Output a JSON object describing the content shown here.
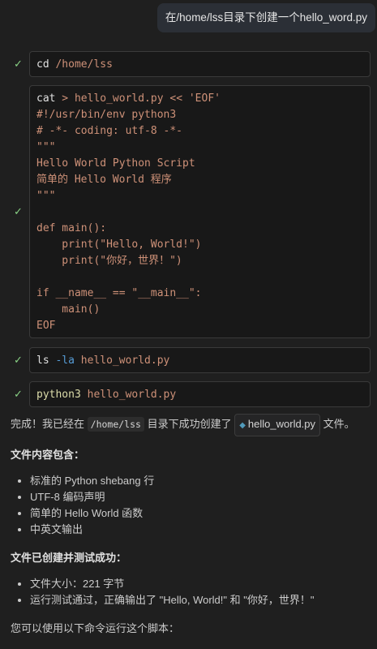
{
  "user_message": "在/home/lss目录下创建一个hello_word.py",
  "steps": [
    {
      "status": "check-icon",
      "cmd": "cd",
      "args": " /home/lss"
    },
    {
      "status": "check-icon",
      "code": [
        {
          "cmd": "cat",
          "rest": " > hello_world.py << 'EOF'"
        },
        {
          "text": "#!/usr/bin/env python3"
        },
        {
          "text": "# -*- coding: utf-8 -*-"
        },
        {
          "text": "\"\"\""
        },
        {
          "text": "Hello World Python Script"
        },
        {
          "text": "简单的 Hello World 程序"
        },
        {
          "text": "\"\"\""
        },
        {
          "text": ""
        },
        {
          "text": "def main():"
        },
        {
          "text": "    print(\"Hello, World!\")"
        },
        {
          "text": "    print(\"你好，世界！\")"
        },
        {
          "text": ""
        },
        {
          "text": "if __name__ == \"__main__\":"
        },
        {
          "text": "    main()"
        },
        {
          "text": "EOF"
        }
      ]
    },
    {
      "status": "check-icon",
      "cmd": "ls",
      "flag": " -la",
      "args": " hello_world.py"
    },
    {
      "status": "check-icon",
      "cmd": "python3",
      "args": " hello_world.py"
    }
  ],
  "answer": {
    "intro_before": "完成！我已经在",
    "intro_path": "/home/lss",
    "intro_mid": "目录下成功创建了",
    "intro_file": "hello_world.py",
    "intro_after": "文件。",
    "contents_heading": "文件内容包含：",
    "contents_items": [
      "标准的 Python shebang 行",
      "UTF-8 编码声明",
      "简单的 Hello World 函数",
      "中英文输出"
    ],
    "test_heading": "文件已创建并测试成功：",
    "test_items": [
      "文件大小：221 字节",
      "运行测试通过，正确输出了 \"Hello, World!\" 和 \"你好，世界！\""
    ],
    "footer": "您可以使用以下命令运行这个脚本："
  }
}
